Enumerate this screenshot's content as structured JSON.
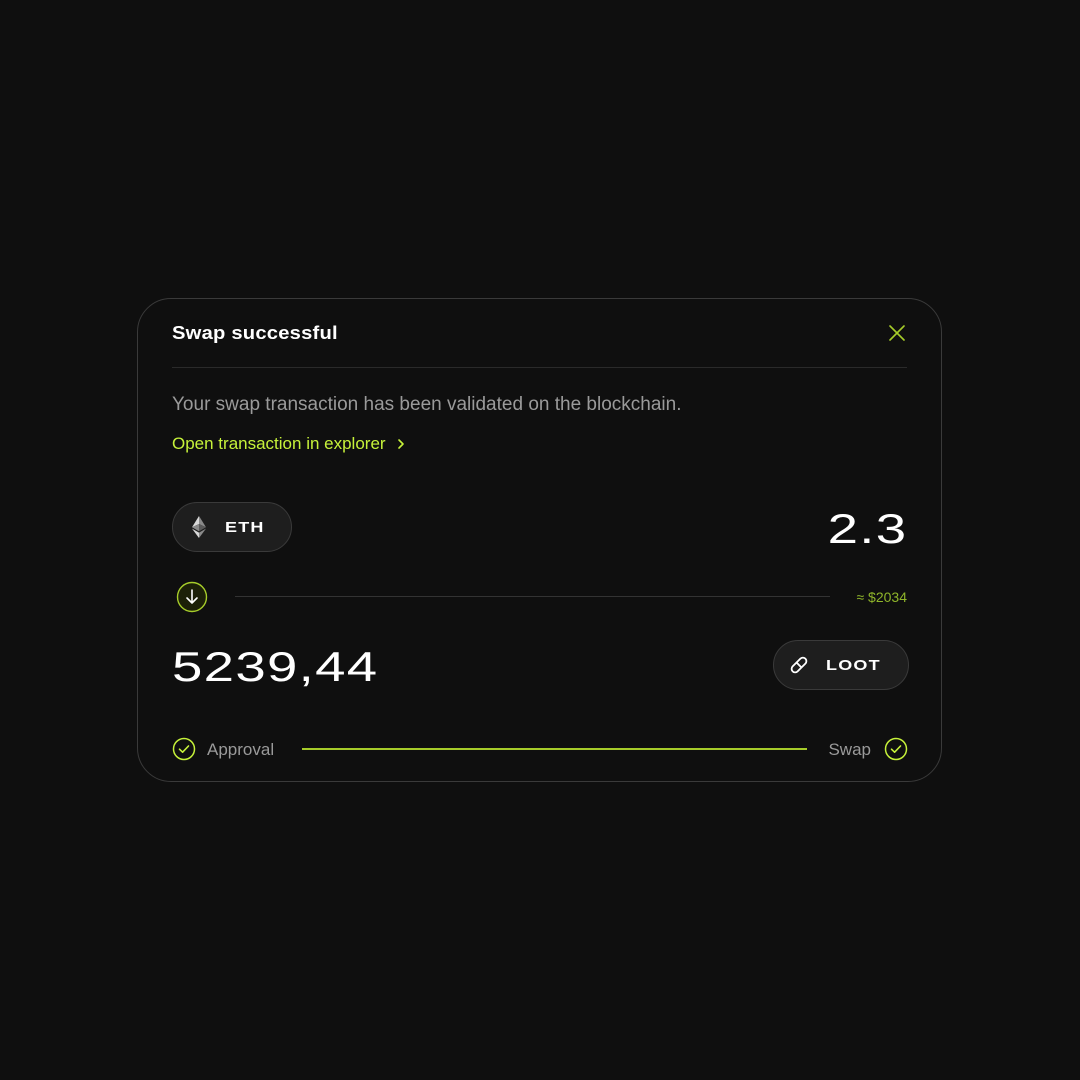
{
  "modal": {
    "title": "Swap successful",
    "message": "Your swap transaction has been validated on the blockchain.",
    "explorer_link": "Open transaction in explorer"
  },
  "swap": {
    "from_token": {
      "symbol": "ETH",
      "icon": "ethereum-icon",
      "amount": "2.3"
    },
    "to_token": {
      "symbol": "LOOT",
      "icon": "loot-link-icon",
      "amount": "5239,44"
    },
    "usd_value": "≈ $2034"
  },
  "steps": [
    {
      "label": "Approval",
      "status": "completed"
    },
    {
      "label": "Swap",
      "status": "completed"
    }
  ],
  "colors": {
    "background": "#0f0f0f",
    "accent": "#c6f23a",
    "text_primary": "#ffffff",
    "text_secondary": "#9a9a9a",
    "border": "#3a3a3a"
  }
}
